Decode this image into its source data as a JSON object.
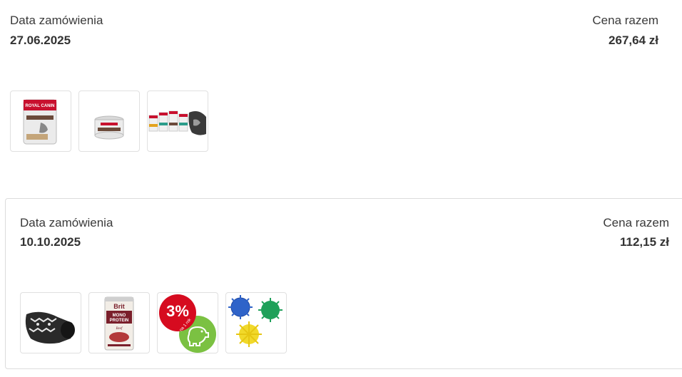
{
  "orders": [
    {
      "date_label": "Data zamówienia",
      "date": "27.06.2025",
      "price_label": "Cena razem",
      "price": "267,64 zł",
      "products": [
        {
          "icon": "royal-canin-can-icon",
          "brand": "ROYAL CANIN"
        },
        {
          "icon": "royal-canin-small-tin-icon"
        },
        {
          "icon": "royal-canin-cans-with-dog-icon"
        }
      ]
    },
    {
      "date_label": "Data zamówienia",
      "date": "10.10.2025",
      "price_label": "Cena razem",
      "price": "112,15 zł",
      "products": [
        {
          "icon": "dog-sweater-icon"
        },
        {
          "icon": "brit-mono-protein-can-icon",
          "brand": "Brit",
          "line1": "MONO",
          "line2": "PROTEIN",
          "flavor": "Beef"
        },
        {
          "icon": "savings-badge-icon",
          "percent": "3%",
          "subtitle": "na 1 rok"
        },
        {
          "icon": "spiky-balls-toy-icon"
        }
      ]
    }
  ]
}
